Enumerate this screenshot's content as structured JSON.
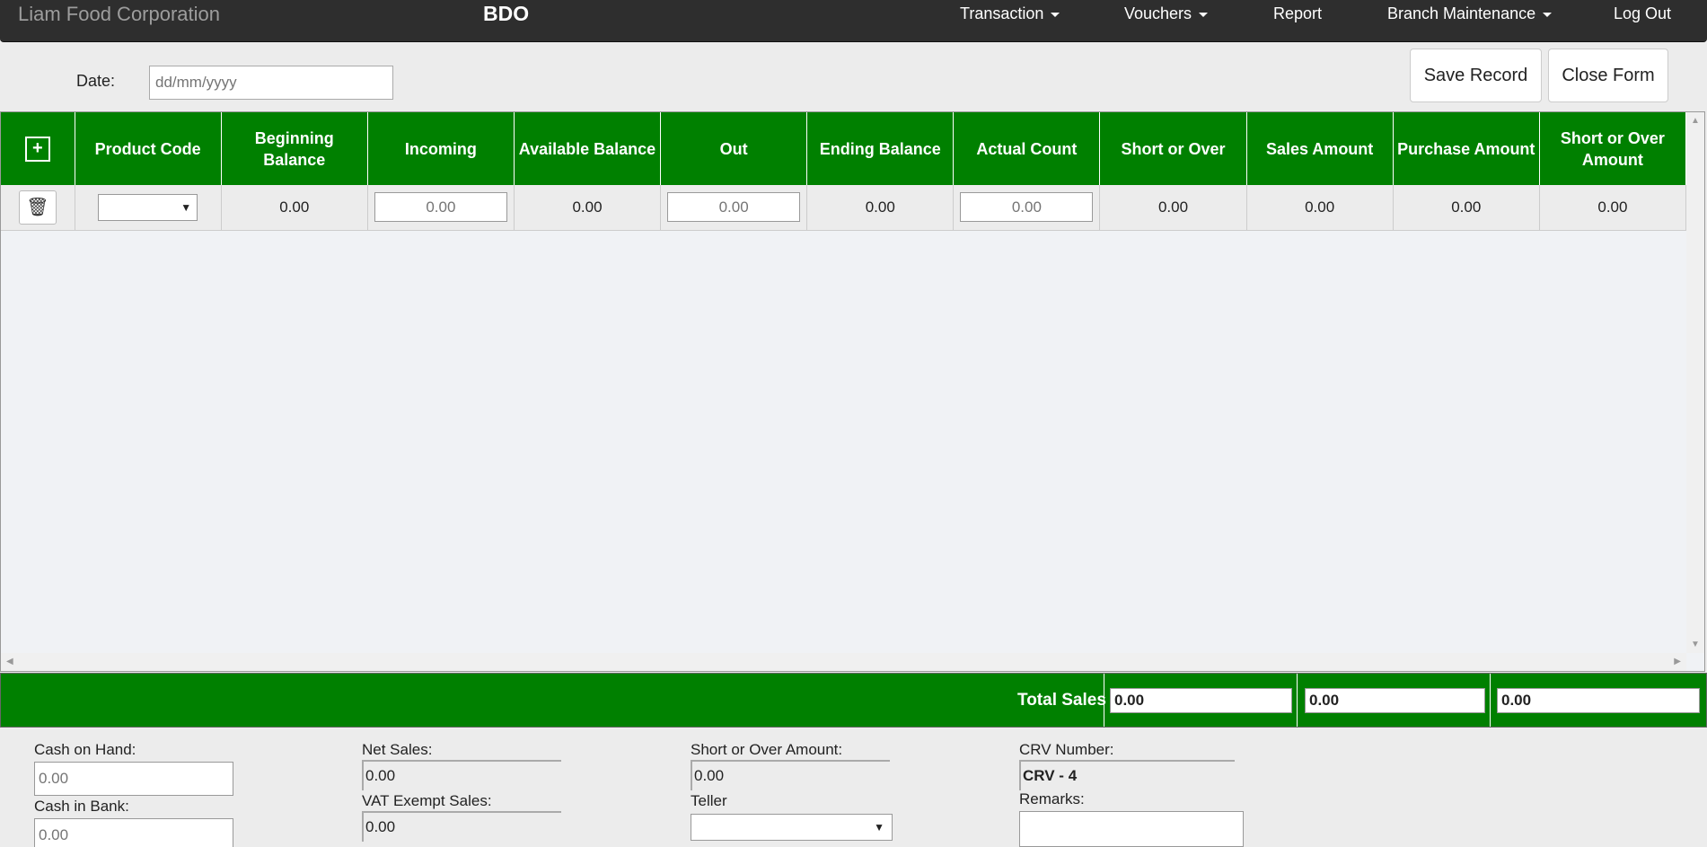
{
  "navbar": {
    "brand": "Liam Food Corporation",
    "bank": "BDO",
    "items": [
      {
        "label": "Transaction",
        "dropdown": true
      },
      {
        "label": "Vouchers",
        "dropdown": true
      },
      {
        "label": "Report",
        "dropdown": false
      },
      {
        "label": "Branch Maintenance",
        "dropdown": true
      },
      {
        "label": "Log Out",
        "dropdown": false
      }
    ]
  },
  "form": {
    "date_label": "Date:",
    "date_placeholder": "dd/mm/yyyy",
    "save_label": "Save Record",
    "close_label": "Close Form"
  },
  "table": {
    "add_icon": "+",
    "delete_icon": "🗑",
    "columns": [
      "Product Code",
      "Beginning Balance",
      "Incoming",
      "Available Balance",
      "Out",
      "Ending Balance",
      "Actual Count",
      "Short or Over",
      "Sales Amount",
      "Purchase Amount",
      "Short or Over Amount"
    ],
    "row": {
      "product_code": "",
      "beginning_balance": "0.00",
      "incoming_placeholder": "0.00",
      "available_balance": "0.00",
      "out_placeholder": "0.00",
      "ending_balance": "0.00",
      "actual_count_placeholder": "0.00",
      "short_or_over": "0.00",
      "sales_amount": "0.00",
      "purchase_amount": "0.00",
      "short_or_over_amount": "0.00"
    }
  },
  "totals": {
    "label": "Total Sales",
    "sales": "0.00",
    "purchase": "0.00",
    "short_or_over": "0.00"
  },
  "footer": {
    "cash_on_hand_label": "Cash on Hand:",
    "cash_on_hand_placeholder": "0.00",
    "cash_in_bank_label": "Cash in Bank:",
    "cash_in_bank_placeholder": "0.00",
    "net_sales_label": "Net Sales:",
    "net_sales": "0.00",
    "vat_exempt_label": "VAT Exempt Sales:",
    "vat_exempt": "0.00",
    "short_over_amount_label": "Short or Over Amount:",
    "short_over_amount": "0.00",
    "teller_label": "Teller",
    "teller_value": "",
    "crv_label": "CRV Number:",
    "crv_value": "CRV - 4",
    "remarks_label": "Remarks:"
  },
  "colors": {
    "accent": "#008000",
    "navbar": "#2e2e2e"
  }
}
